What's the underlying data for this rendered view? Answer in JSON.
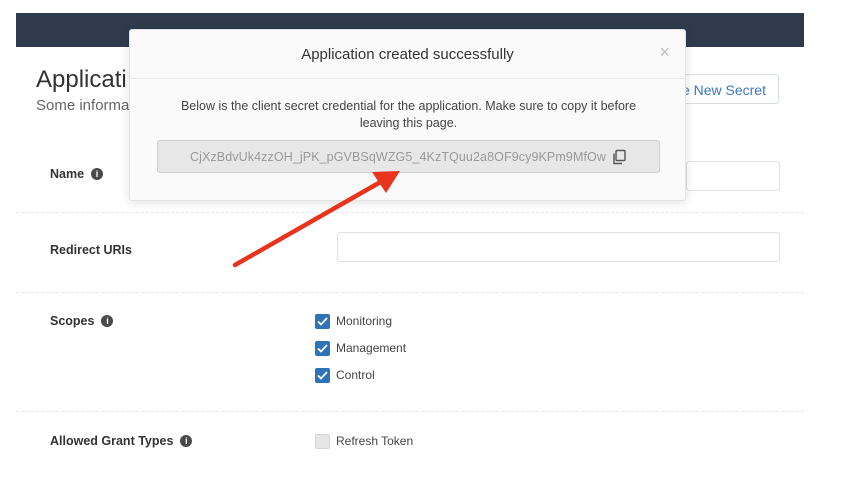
{
  "page": {
    "title": "Applicati",
    "subtitle": "Some informa",
    "new_secret_label": "e New Secret"
  },
  "form": {
    "name_label": "Name",
    "redirect_label": "Redirect URIs",
    "scopes_label": "Scopes",
    "grant_label": "Allowed Grant Types",
    "scopes": [
      {
        "label": "Monitoring",
        "checked": true
      },
      {
        "label": "Management",
        "checked": true
      },
      {
        "label": "Control",
        "checked": true
      }
    ],
    "grant_types": [
      {
        "label": "Refresh Token",
        "checked": false
      }
    ]
  },
  "modal": {
    "title": "Application created successfully",
    "close": "×",
    "body_line1": "Below is the client secret credential for the application. Make sure to copy it before",
    "body_line2": "leaving this page.",
    "secret": "CjXzBdvUk4zzOH_jPK_pGVBSqWZG5_4KzTQuu2a8OF9cy9KPm9MfOw"
  },
  "colors": {
    "topbar": "#2f3b4c",
    "accent": "#2e73b8",
    "arrow": "#e8341c"
  },
  "icons": {
    "info": "info-icon",
    "copy": "copy-icon",
    "check": "check-icon",
    "close": "close-icon"
  }
}
